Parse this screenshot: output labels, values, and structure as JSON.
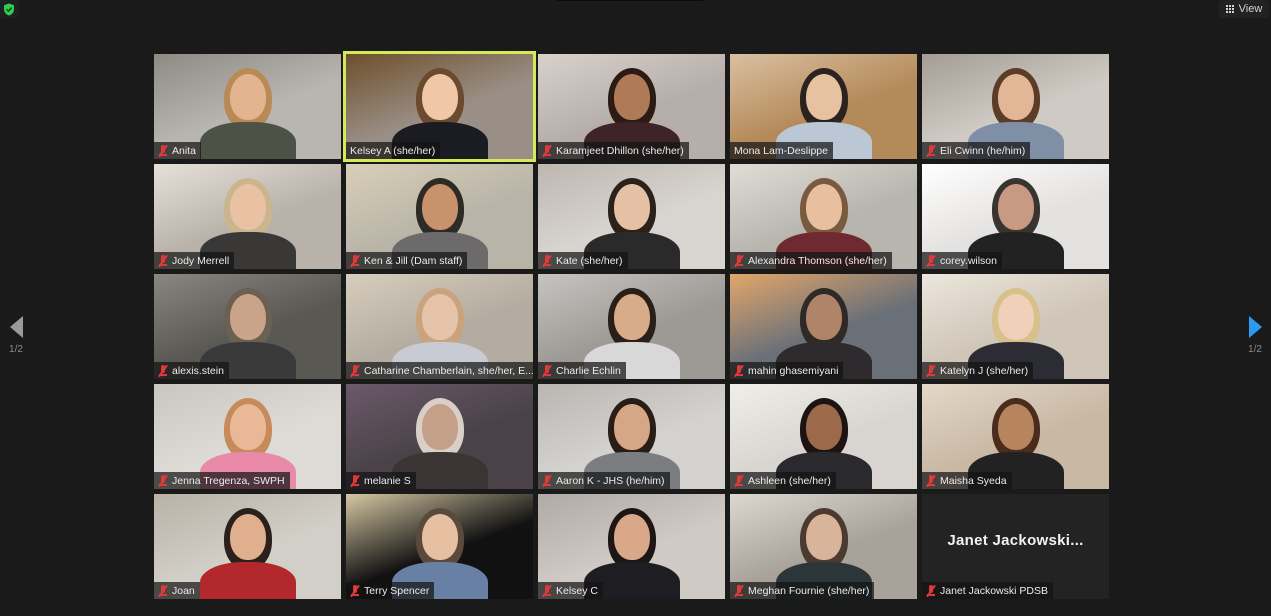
{
  "app": {
    "security_icon": "shield-check-icon",
    "security_color": "#2ecc55",
    "view_button": {
      "label": "View",
      "icon": "grid-icon"
    },
    "active_speaker_color": "#d4ea5a",
    "mute_color": "#e0393a"
  },
  "pagination": {
    "prev": {
      "icon": "triangle-left-icon",
      "label": "1/2",
      "color": "#9a9a9a"
    },
    "next": {
      "icon": "triangle-right-icon",
      "label": "1/2",
      "color": "#2a9bf0"
    }
  },
  "participants": [
    {
      "name": "Anita",
      "muted": true,
      "active": false,
      "video": true
    },
    {
      "name": "Kelsey A (she/her)",
      "muted": false,
      "active": true,
      "video": true
    },
    {
      "name": "Karamjeet Dhillon (she/her)",
      "muted": true,
      "active": false,
      "video": true
    },
    {
      "name": "Mona Lam-Deslippe",
      "muted": false,
      "active": false,
      "video": true
    },
    {
      "name": "Eli Cwinn (he/him)",
      "muted": true,
      "active": false,
      "video": true
    },
    {
      "name": "Jody Merrell",
      "muted": true,
      "active": false,
      "video": true
    },
    {
      "name": "Ken & Jill (Dam staff)",
      "muted": true,
      "active": false,
      "video": true
    },
    {
      "name": "Kate (she/her)",
      "muted": true,
      "active": false,
      "video": true
    },
    {
      "name": "Alexandra Thomson (she/her)",
      "muted": true,
      "active": false,
      "video": true
    },
    {
      "name": "corey.wilson",
      "muted": true,
      "active": false,
      "video": true
    },
    {
      "name": "alexis.stein",
      "muted": true,
      "active": false,
      "video": true
    },
    {
      "name": "Catharine Chamberlain, she/her, E...",
      "muted": true,
      "active": false,
      "video": true
    },
    {
      "name": "Charlie Echlin",
      "muted": true,
      "active": false,
      "video": true
    },
    {
      "name": "mahin ghasemiyani",
      "muted": true,
      "active": false,
      "video": true
    },
    {
      "name": "Katelyn J (she/her)",
      "muted": true,
      "active": false,
      "video": true
    },
    {
      "name": "Jenna Tregenza, SWPH",
      "muted": true,
      "active": false,
      "video": true
    },
    {
      "name": "melanie S",
      "muted": true,
      "active": false,
      "video": true
    },
    {
      "name": "Aaron K - JHS (he/him)",
      "muted": true,
      "active": false,
      "video": true
    },
    {
      "name": "Ashleen (she/her)",
      "muted": true,
      "active": false,
      "video": true
    },
    {
      "name": "Maisha Syeda",
      "muted": true,
      "active": false,
      "video": true
    },
    {
      "name": "Joan",
      "muted": true,
      "active": false,
      "video": true
    },
    {
      "name": "Terry Spencer",
      "muted": true,
      "active": false,
      "video": true
    },
    {
      "name": "Kelsey C",
      "muted": true,
      "active": false,
      "video": true
    },
    {
      "name": "Meghan Fournie (she/her)",
      "muted": true,
      "active": false,
      "video": true
    },
    {
      "name": "Janet Jackowski PDSB",
      "muted": true,
      "active": false,
      "video": false,
      "display_name": "Janet  Jackowski..."
    }
  ]
}
